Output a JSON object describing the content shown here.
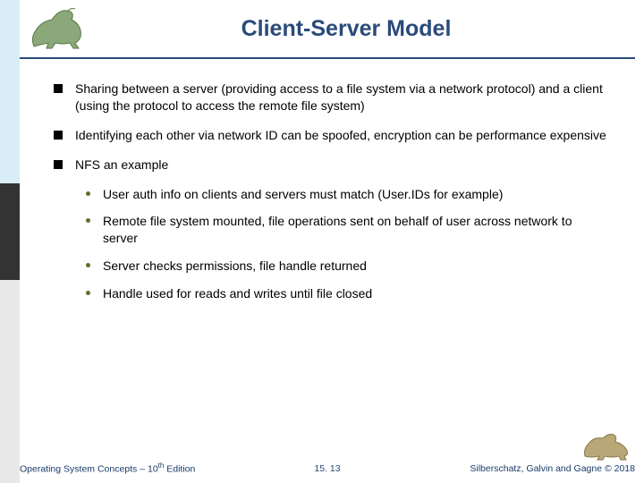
{
  "title": "Client-Server Model",
  "bullets": {
    "b1": "Sharing between a server (providing access to a file system via a network protocol) and a client (using the protocol to access the remote file system)",
    "b2": "Identifying each other via network ID can be spoofed, encryption can be performance expensive",
    "b3": "NFS an example",
    "sub1": "User auth info on clients and servers must match (User.IDs for example)",
    "sub2": "Remote file system mounted, file operations sent on behalf of user across network to server",
    "sub3": "Server checks permissions, file handle returned",
    "sub4": "Handle used for reads and writes until file closed"
  },
  "footer": {
    "left_a": "Operating System Concepts – 10",
    "left_sup": "th",
    "left_b": " Edition",
    "center": "15. 13",
    "right": "Silberschatz, Galvin and Gagne © 2018"
  }
}
